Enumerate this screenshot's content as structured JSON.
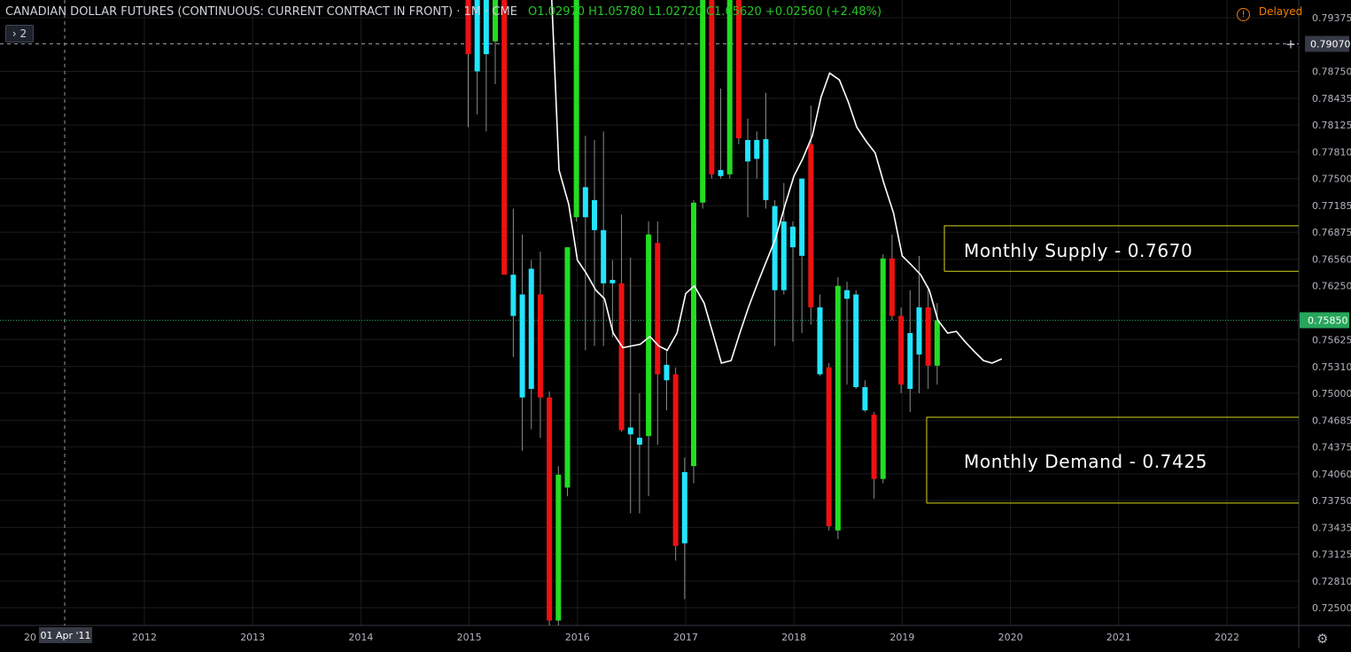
{
  "header": {
    "symbol": "CANADIAN DOLLAR FUTURES (CONTINUOUS: CURRENT CONTRACT IN FRONT) · 1M · CME",
    "ohlc": "O1.02970 H1.05780 L1.02720 C1.05620 +0.02560 (+2.48%)",
    "delayed_label": "Delayed",
    "collapse_label": "2"
  },
  "colors": {
    "background": "#000000",
    "bull": "#22dd22",
    "bear": "#ee1111",
    "doji_up": "#22e5ff",
    "ma": "#ffffff",
    "zone": "#d6d61e",
    "price_label_green": "#26a65b"
  },
  "icons": {
    "delayed": "warning-icon",
    "collapse": "chevron-right-icon",
    "settings": "gear-icon"
  },
  "chart_data": {
    "type": "candlestick",
    "title": "",
    "timeframe": "1M",
    "y_ticks": [
      "0.79375",
      "0.79070",
      "0.78750",
      "0.78435",
      "0.78125",
      "0.77810",
      "0.77500",
      "0.77185",
      "0.76875",
      "0.76560",
      "0.76250",
      "0.75850",
      "0.75625",
      "0.75310",
      "0.75000",
      "0.74685",
      "0.74375",
      "0.74060",
      "0.73750",
      "0.73435",
      "0.73125",
      "0.72810",
      "0.72500"
    ],
    "ylim": [
      0.7225,
      0.797
    ],
    "x_ticks": [
      "2012",
      "2013",
      "2014",
      "2015",
      "2016",
      "2017",
      "2018",
      "2019",
      "2020",
      "2021",
      "2022"
    ],
    "x_tick_first": "20",
    "crosshair": {
      "date_label": "01 Apr '11",
      "price_label": "0.79070",
      "price": 0.7907
    },
    "current_price": {
      "label": "0.75850",
      "price": 0.7585
    },
    "zones": [
      {
        "name": "Monthly Supply - 0.7670",
        "top": 0.7695,
        "bottom": 0.7642
      },
      {
        "name": "Monthly Demand - 0.7425",
        "top": 0.7472,
        "bottom": 0.7372
      }
    ],
    "candles": [
      {
        "o": 0.799,
        "h": 0.7995,
        "l": 0.781,
        "c": 0.7895,
        "dir": "down"
      },
      {
        "o": 0.7875,
        "h": 0.7995,
        "l": 0.7825,
        "c": 0.7995,
        "dir": "cyan"
      },
      {
        "o": 0.797,
        "h": 0.7995,
        "l": 0.7805,
        "c": 0.7895,
        "dir": "cyan"
      },
      {
        "o": 0.791,
        "h": 0.7995,
        "l": 0.786,
        "c": 0.7995,
        "dir": "up"
      },
      {
        "o": 0.799,
        "h": 0.7995,
        "l": 0.7685,
        "c": 0.7638,
        "dir": "down"
      },
      {
        "o": 0.759,
        "h": 0.7715,
        "l": 0.7542,
        "c": 0.7638,
        "dir": "cyan"
      },
      {
        "o": 0.7495,
        "h": 0.7685,
        "l": 0.7433,
        "c": 0.7615,
        "dir": "cyan"
      },
      {
        "o": 0.7505,
        "h": 0.7655,
        "l": 0.7458,
        "c": 0.7645,
        "dir": "cyan"
      },
      {
        "o": 0.7615,
        "h": 0.7665,
        "l": 0.7448,
        "c": 0.7495,
        "dir": "down"
      },
      {
        "o": 0.7495,
        "h": 0.7502,
        "l": 0.7225,
        "c": 0.7235,
        "dir": "down"
      },
      {
        "o": 0.7405,
        "h": 0.7415,
        "l": 0.7225,
        "c": 0.7235,
        "dir": "up"
      },
      {
        "o": 0.739,
        "h": 0.767,
        "l": 0.738,
        "c": 0.767,
        "dir": "up"
      },
      {
        "o": 0.7705,
        "h": 0.7995,
        "l": 0.77,
        "c": 0.7995,
        "dir": "up"
      },
      {
        "o": 0.7705,
        "h": 0.78,
        "l": 0.755,
        "c": 0.774,
        "dir": "cyan"
      },
      {
        "o": 0.769,
        "h": 0.7795,
        "l": 0.7555,
        "c": 0.7725,
        "dir": "cyan"
      },
      {
        "o": 0.7628,
        "h": 0.7805,
        "l": 0.7555,
        "c": 0.769,
        "dir": "cyan"
      },
      {
        "o": 0.7628,
        "h": 0.7655,
        "l": 0.7565,
        "c": 0.7632,
        "dir": "cyan"
      },
      {
        "o": 0.7628,
        "h": 0.7708,
        "l": 0.7455,
        "c": 0.7457,
        "dir": "down"
      },
      {
        "o": 0.746,
        "h": 0.7658,
        "l": 0.736,
        "c": 0.7452,
        "dir": "cyan"
      },
      {
        "o": 0.744,
        "h": 0.75,
        "l": 0.736,
        "c": 0.7448,
        "dir": "cyan"
      },
      {
        "o": 0.745,
        "h": 0.77,
        "l": 0.738,
        "c": 0.7685,
        "dir": "up"
      },
      {
        "o": 0.7675,
        "h": 0.77,
        "l": 0.744,
        "c": 0.7522,
        "dir": "down"
      },
      {
        "o": 0.7533,
        "h": 0.755,
        "l": 0.748,
        "c": 0.7515,
        "dir": "cyan"
      },
      {
        "o": 0.7522,
        "h": 0.753,
        "l": 0.7305,
        "c": 0.7322,
        "dir": "down"
      },
      {
        "o": 0.7325,
        "h": 0.7425,
        "l": 0.726,
        "c": 0.7408,
        "dir": "cyan"
      },
      {
        "o": 0.7415,
        "h": 0.7725,
        "l": 0.7395,
        "c": 0.7722,
        "dir": "up"
      },
      {
        "o": 0.7722,
        "h": 0.7995,
        "l": 0.7715,
        "c": 0.7995,
        "dir": "up"
      },
      {
        "o": 0.7975,
        "h": 0.7995,
        "l": 0.775,
        "c": 0.7755,
        "dir": "down"
      },
      {
        "o": 0.776,
        "h": 0.7855,
        "l": 0.775,
        "c": 0.7753,
        "dir": "cyan"
      },
      {
        "o": 0.7755,
        "h": 0.7995,
        "l": 0.775,
        "c": 0.7995,
        "dir": "up"
      },
      {
        "o": 0.7995,
        "h": 0.7995,
        "l": 0.779,
        "c": 0.7797,
        "dir": "down"
      },
      {
        "o": 0.7795,
        "h": 0.782,
        "l": 0.7705,
        "c": 0.777,
        "dir": "cyan"
      },
      {
        "o": 0.7795,
        "h": 0.7805,
        "l": 0.775,
        "c": 0.7773,
        "dir": "cyan"
      },
      {
        "o": 0.7796,
        "h": 0.785,
        "l": 0.7715,
        "c": 0.7725,
        "dir": "cyan"
      },
      {
        "o": 0.7718,
        "h": 0.7725,
        "l": 0.7555,
        "c": 0.762,
        "dir": "cyan"
      },
      {
        "o": 0.77,
        "h": 0.7745,
        "l": 0.7615,
        "c": 0.762,
        "dir": "cyan"
      },
      {
        "o": 0.7694,
        "h": 0.77,
        "l": 0.756,
        "c": 0.767,
        "dir": "cyan"
      },
      {
        "o": 0.766,
        "h": 0.775,
        "l": 0.757,
        "c": 0.775,
        "dir": "cyan"
      },
      {
        "o": 0.779,
        "h": 0.7835,
        "l": 0.758,
        "c": 0.76,
        "dir": "down"
      },
      {
        "o": 0.76,
        "h": 0.7615,
        "l": 0.752,
        "c": 0.7522,
        "dir": "cyan"
      },
      {
        "o": 0.753,
        "h": 0.7535,
        "l": 0.734,
        "c": 0.7345,
        "dir": "down"
      },
      {
        "o": 0.734,
        "h": 0.7635,
        "l": 0.733,
        "c": 0.7625,
        "dir": "up"
      },
      {
        "o": 0.762,
        "h": 0.763,
        "l": 0.751,
        "c": 0.761,
        "dir": "cyan"
      },
      {
        "o": 0.7615,
        "h": 0.762,
        "l": 0.7505,
        "c": 0.7507,
        "dir": "cyan"
      },
      {
        "o": 0.7507,
        "h": 0.7515,
        "l": 0.7478,
        "c": 0.748,
        "dir": "cyan"
      },
      {
        "o": 0.7475,
        "h": 0.7478,
        "l": 0.7377,
        "c": 0.74,
        "dir": "down"
      },
      {
        "o": 0.74,
        "h": 0.7662,
        "l": 0.7395,
        "c": 0.7657,
        "dir": "up"
      },
      {
        "o": 0.7657,
        "h": 0.7685,
        "l": 0.7585,
        "c": 0.759,
        "dir": "down"
      },
      {
        "o": 0.759,
        "h": 0.76,
        "l": 0.75,
        "c": 0.751,
        "dir": "down"
      },
      {
        "o": 0.7505,
        "h": 0.762,
        "l": 0.7478,
        "c": 0.757,
        "dir": "cyan"
      },
      {
        "o": 0.7545,
        "h": 0.766,
        "l": 0.75,
        "c": 0.76,
        "dir": "cyan"
      },
      {
        "o": 0.76,
        "h": 0.7625,
        "l": 0.7505,
        "c": 0.7532,
        "dir": "down"
      },
      {
        "o": 0.7532,
        "h": 0.7605,
        "l": 0.751,
        "c": 0.7585,
        "dir": "up"
      }
    ],
    "ma": [
      [
        2015.75,
        0.7995
      ],
      [
        2015.83,
        0.776
      ],
      [
        2015.92,
        0.772
      ],
      [
        2016.0,
        0.7655
      ],
      [
        2016.08,
        0.764
      ],
      [
        2016.17,
        0.762
      ],
      [
        2016.25,
        0.761
      ],
      [
        2016.33,
        0.757
      ],
      [
        2016.42,
        0.7553
      ],
      [
        2016.5,
        0.7555
      ],
      [
        2016.58,
        0.7557
      ],
      [
        2016.67,
        0.7566
      ],
      [
        2016.75,
        0.7555
      ],
      [
        2016.83,
        0.755
      ],
      [
        2016.92,
        0.757
      ],
      [
        2017.0,
        0.7616
      ],
      [
        2017.08,
        0.7625
      ],
      [
        2017.17,
        0.7605
      ],
      [
        2017.25,
        0.757
      ],
      [
        2017.33,
        0.7535
      ],
      [
        2017.42,
        0.7538
      ],
      [
        2017.5,
        0.757
      ],
      [
        2017.58,
        0.76
      ],
      [
        2017.67,
        0.763
      ],
      [
        2017.75,
        0.7655
      ],
      [
        2017.83,
        0.768
      ],
      [
        2017.92,
        0.772
      ],
      [
        2018.0,
        0.7753
      ],
      [
        2018.08,
        0.7773
      ],
      [
        2018.17,
        0.78
      ],
      [
        2018.25,
        0.7845
      ],
      [
        2018.33,
        0.7873
      ],
      [
        2018.42,
        0.7865
      ],
      [
        2018.5,
        0.784
      ],
      [
        2018.58,
        0.781
      ],
      [
        2018.67,
        0.7793
      ],
      [
        2018.75,
        0.778
      ],
      [
        2018.83,
        0.7745
      ],
      [
        2018.92,
        0.771
      ],
      [
        2019.0,
        0.766
      ],
      [
        2019.08,
        0.765
      ],
      [
        2019.17,
        0.7638
      ],
      [
        2019.25,
        0.762
      ],
      [
        2019.33,
        0.7585
      ],
      [
        2019.42,
        0.757
      ],
      [
        2019.5,
        0.7572
      ],
      [
        2019.58,
        0.756
      ],
      [
        2019.67,
        0.7548
      ],
      [
        2019.75,
        0.7538
      ],
      [
        2019.83,
        0.7535
      ],
      [
        2019.92,
        0.754
      ]
    ]
  }
}
